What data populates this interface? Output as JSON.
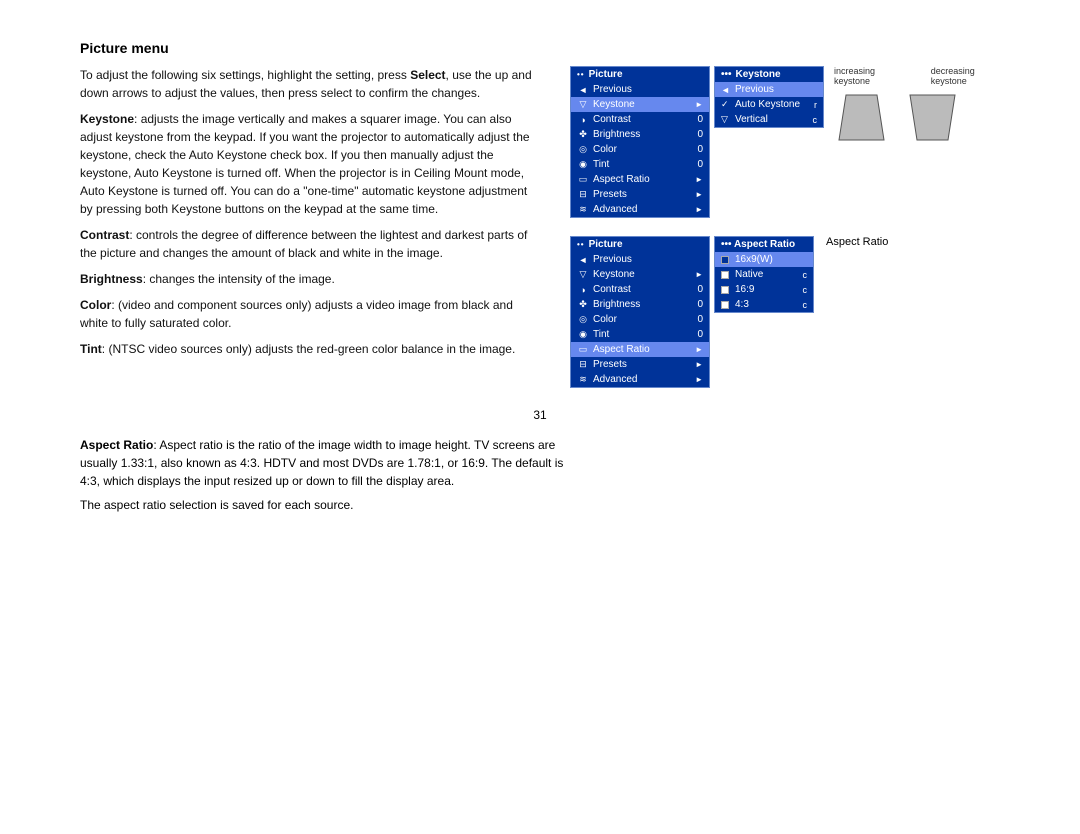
{
  "page": {
    "title": "Picture menu",
    "page_number": "31"
  },
  "text": {
    "intro": "To adjust the following six settings, highlight the setting, press Select, use the up and down arrows to adjust the values, then press select to confirm the changes.",
    "keystone": "Keystone: adjusts the image vertically and makes a squarer image. You can also adjust keystone from the keypad. If you want the projector to automatically adjust the keystone, check the Auto Keystone check box. If you then manually adjust the keystone, Auto Keystone is turned off. When the projector is in Ceiling Mount mode, Auto Keystone is turned off. You can do a \"one-time\" automatic keystone adjustment by pressing both Keystone buttons on the keypad at the same time.",
    "contrast": "Contrast: controls the degree of difference between the lightest and darkest parts of the picture and changes the amount of black and white in the image.",
    "brightness": "Brightness: changes the intensity of the image.",
    "color": "Color: (video and component sources only) adjusts a video image from black and white to fully saturated color.",
    "tint": "Tint: (NTSC video sources only) adjusts the red-green color balance in the image.",
    "aspect_ratio_title": "Aspect Ratio",
    "aspect_ratio_body": "Aspect Ratio: Aspect ratio is the ratio of the image width to image height. TV screens are usually 1.33:1, also known as 4:3. HDTV and most DVDs are 1.78:1, or 16:9. The default is 4:3, which displays the input resized up or down to fill the display area.",
    "aspect_ratio_note": "The aspect ratio selection is saved for each source."
  },
  "menu1": {
    "title": "Picture",
    "dots": "••",
    "items": [
      {
        "icon": "◄",
        "label": "Previous",
        "value": "",
        "arrow": "",
        "highlighted": false
      },
      {
        "icon": "▽",
        "label": "Keystone",
        "value": "",
        "arrow": "►",
        "highlighted": true
      },
      {
        "icon": "◑",
        "label": "Contrast",
        "value": "0",
        "arrow": "",
        "highlighted": false
      },
      {
        "icon": "☀",
        "label": "Brightness",
        "value": "0",
        "arrow": "",
        "highlighted": false
      },
      {
        "icon": "◎",
        "label": "Color",
        "value": "0",
        "arrow": "",
        "highlighted": false
      },
      {
        "icon": "◉",
        "label": "Tint",
        "value": "0",
        "arrow": "",
        "highlighted": false
      },
      {
        "icon": "□",
        "label": "Aspect Ratio",
        "value": "",
        "arrow": "►",
        "highlighted": false
      },
      {
        "icon": "⊟",
        "label": "Presets",
        "value": "",
        "arrow": "►",
        "highlighted": false
      },
      {
        "icon": "≋",
        "label": "Advanced",
        "value": "",
        "arrow": "►",
        "highlighted": false
      }
    ]
  },
  "keystone_submenu": {
    "title": "Keystone",
    "dots": "•••",
    "items": [
      {
        "check": "",
        "label": "Previous",
        "highlighted": true
      },
      {
        "check": "✓",
        "label": "Auto Keystone",
        "shortcut": "r",
        "highlighted": false
      },
      {
        "check": "▽",
        "label": "Vertical",
        "shortcut": "c",
        "highlighted": false
      }
    ]
  },
  "keystone_diagrams": {
    "increasing_label": "increasing keystone",
    "decreasing_label": "decreasing keystone"
  },
  "menu2": {
    "title": "Picture",
    "dots": "••",
    "items": [
      {
        "icon": "◄",
        "label": "Previous",
        "value": "",
        "arrow": "",
        "highlighted": false
      },
      {
        "icon": "▽",
        "label": "Keystone",
        "value": "",
        "arrow": "►",
        "highlighted": false
      },
      {
        "icon": "◑",
        "label": "Contrast",
        "value": "0",
        "arrow": "",
        "highlighted": false
      },
      {
        "icon": "☀",
        "label": "Brightness",
        "value": "0",
        "arrow": "",
        "highlighted": false
      },
      {
        "icon": "◎",
        "label": "Color",
        "value": "0",
        "arrow": "",
        "highlighted": false
      },
      {
        "icon": "◉",
        "label": "Tint",
        "value": "0",
        "arrow": "",
        "highlighted": false
      },
      {
        "icon": "□",
        "label": "Aspect Ratio",
        "value": "",
        "arrow": "►",
        "highlighted": true
      },
      {
        "icon": "⊟",
        "label": "Presets",
        "value": "",
        "arrow": "►",
        "highlighted": false
      },
      {
        "icon": "≋",
        "label": "Advanced",
        "value": "",
        "arrow": "►",
        "highlighted": false
      }
    ]
  },
  "aspect_submenu": {
    "title": "Aspect Ratio",
    "dots": "•••",
    "items": [
      {
        "radio": true,
        "label": "16x9(W)",
        "highlighted": true
      },
      {
        "radio": false,
        "label": "Native",
        "shortcut": "c",
        "highlighted": false
      },
      {
        "radio": false,
        "label": "16:9",
        "shortcut": "c",
        "highlighted": false
      },
      {
        "radio": false,
        "label": "4:3",
        "shortcut": "c",
        "highlighted": false
      }
    ],
    "side_label": "Aspect Ratio"
  }
}
